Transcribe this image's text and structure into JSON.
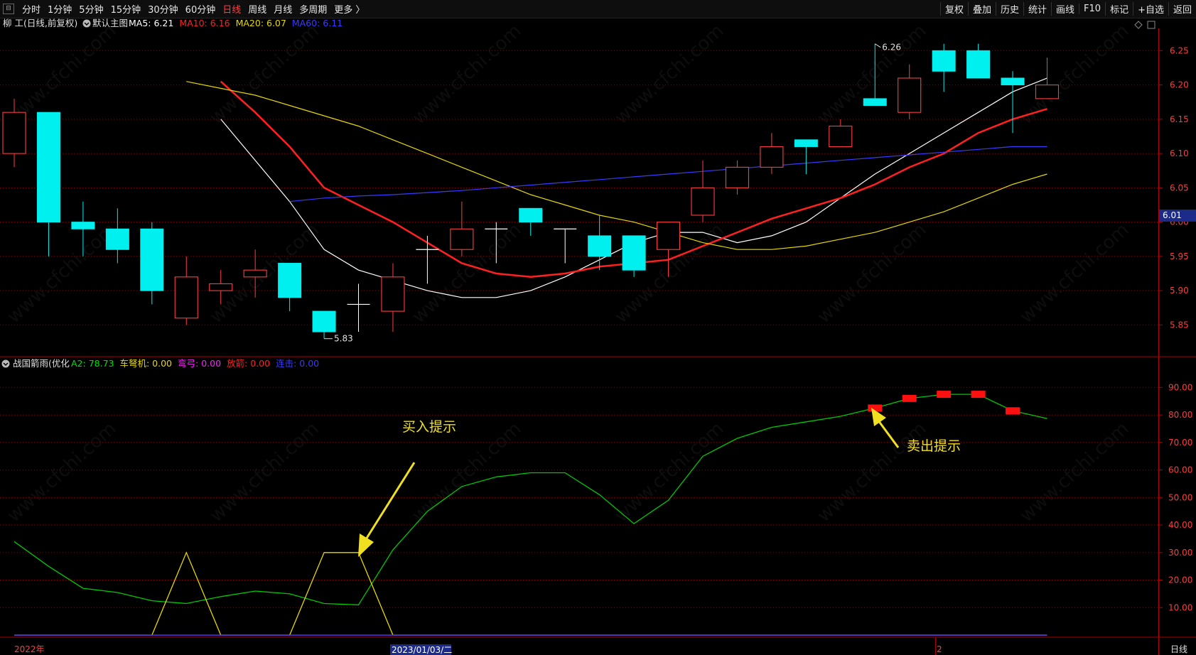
{
  "toolbar": {
    "timeframes": [
      "分时",
      "1分钟",
      "5分钟",
      "15分钟",
      "30分钟",
      "60分钟",
      "日线",
      "周线",
      "月线",
      "多周期",
      "更多 〉"
    ],
    "active_timeframe": "日线",
    "right_buttons": [
      "复权",
      "叠加",
      "历史",
      "统计",
      "画线",
      "F10",
      "标记",
      "+自选",
      "返回"
    ]
  },
  "main_legend": {
    "stock": "柳 工(日线,前复权)",
    "template": "默认主图",
    "ma": [
      {
        "label": "MA5: 6.21",
        "color": "#ffffff"
      },
      {
        "label": "MA10: 6.16",
        "color": "#ff2020"
      },
      {
        "label": "MA20: 6.07",
        "color": "#e6d800"
      },
      {
        "label": "MA60: 6.11",
        "color": "#3a3aff"
      }
    ]
  },
  "indicator_legend": {
    "name": "战国箭雨(优化",
    "items": [
      {
        "label": "A2: 78.73",
        "color": "#00e000"
      },
      {
        "label": "车弩机: 0.00",
        "color": "#e6d800"
      },
      {
        "label": "弯弓: 0.00",
        "color": "#ff20ff"
      },
      {
        "label": "放箭: 0.00",
        "color": "#ff2020"
      },
      {
        "label": "连击: 0.00",
        "color": "#3a3aff"
      }
    ]
  },
  "price_axis": {
    "ticks": [
      "6.25",
      "6.20",
      "6.15",
      "6.10",
      "6.05",
      "6.00",
      "5.95",
      "5.90",
      "5.85"
    ],
    "current_price": "6.01"
  },
  "indicator_axis": {
    "ticks": [
      "90.00",
      "80.00",
      "70.00",
      "60.00",
      "50.00",
      "40.00",
      "30.00",
      "20.00",
      "10.00"
    ]
  },
  "date_axis": {
    "left": "2022年",
    "cursor": "2023/01/03/二",
    "mid": "2",
    "period": "日线"
  },
  "annotations": {
    "high": "6.26",
    "low": "5.83",
    "buy": "买入提示",
    "sell": "卖出提示"
  },
  "watermark": "www.cfchi.com",
  "chart_data": [
    {
      "type": "candlestick",
      "title": "柳 工(日线,前复权)",
      "ylim": [
        5.81,
        6.27
      ],
      "up_color": "#ff3c3c",
      "down_color": "#00f0f0",
      "candles": [
        {
          "o": 6.1,
          "h": 6.18,
          "l": 6.08,
          "c": 6.16
        },
        {
          "o": 6.16,
          "h": 6.16,
          "l": 5.95,
          "c": 6.0
        },
        {
          "o": 6.0,
          "h": 6.03,
          "l": 5.95,
          "c": 5.99
        },
        {
          "o": 5.99,
          "h": 6.02,
          "l": 5.94,
          "c": 5.96
        },
        {
          "o": 5.99,
          "h": 6.0,
          "l": 5.88,
          "c": 5.9
        },
        {
          "o": 5.86,
          "h": 5.95,
          "l": 5.85,
          "c": 5.92
        },
        {
          "o": 5.9,
          "h": 5.93,
          "l": 5.88,
          "c": 5.91
        },
        {
          "o": 5.92,
          "h": 5.96,
          "l": 5.89,
          "c": 5.93
        },
        {
          "o": 5.94,
          "h": 5.94,
          "l": 5.87,
          "c": 5.89
        },
        {
          "o": 5.87,
          "h": 5.87,
          "l": 5.83,
          "c": 5.84
        },
        {
          "o": 5.88,
          "h": 5.91,
          "l": 5.84,
          "c": 5.88
        },
        {
          "o": 5.87,
          "h": 5.94,
          "l": 5.84,
          "c": 5.92
        },
        {
          "o": 5.96,
          "h": 5.98,
          "l": 5.91,
          "c": 5.96
        },
        {
          "o": 5.96,
          "h": 6.03,
          "l": 5.95,
          "c": 5.99
        },
        {
          "o": 5.99,
          "h": 6.0,
          "l": 5.94,
          "c": 5.99
        },
        {
          "o": 6.02,
          "h": 6.02,
          "l": 5.98,
          "c": 6.0
        },
        {
          "o": 5.99,
          "h": 5.99,
          "l": 5.94,
          "c": 5.99
        },
        {
          "o": 5.98,
          "h": 6.01,
          "l": 5.93,
          "c": 5.95
        },
        {
          "o": 5.98,
          "h": 5.98,
          "l": 5.92,
          "c": 5.93
        },
        {
          "o": 5.96,
          "h": 6.0,
          "l": 5.92,
          "c": 6.0
        },
        {
          "o": 6.01,
          "h": 6.09,
          "l": 6.0,
          "c": 6.05
        },
        {
          "o": 6.05,
          "h": 6.09,
          "l": 6.04,
          "c": 6.08
        },
        {
          "o": 6.08,
          "h": 6.13,
          "l": 6.07,
          "c": 6.11
        },
        {
          "o": 6.12,
          "h": 6.12,
          "l": 6.07,
          "c": 6.11
        },
        {
          "o": 6.11,
          "h": 6.15,
          "l": 6.11,
          "c": 6.14
        },
        {
          "o": 6.18,
          "h": 6.26,
          "l": 6.17,
          "c": 6.17
        },
        {
          "o": 6.16,
          "h": 6.23,
          "l": 6.15,
          "c": 6.21
        },
        {
          "o": 6.25,
          "h": 6.26,
          "l": 6.19,
          "c": 6.22
        },
        {
          "o": 6.25,
          "h": 6.26,
          "l": 6.21,
          "c": 6.21
        },
        {
          "o": 6.21,
          "h": 6.22,
          "l": 6.13,
          "c": 6.2
        },
        {
          "o": 6.18,
          "h": 6.24,
          "l": 6.18,
          "c": 6.2
        }
      ],
      "series": [
        {
          "name": "MA5",
          "color": "#ffffff",
          "width": 1.2,
          "values": [
            6.15,
            6.09,
            6.03,
            5.96,
            5.93,
            5.915,
            5.9,
            5.89,
            5.89,
            5.9,
            5.92,
            5.945,
            5.97,
            5.985,
            5.985,
            5.97,
            5.98,
            6.0,
            6.035,
            6.07,
            6.1,
            6.13,
            6.16,
            6.19,
            6.21
          ]
        },
        {
          "name": "MA10",
          "color": "#ff2020",
          "width": 2.5,
          "values": [
            6.205,
            6.16,
            6.11,
            6.05,
            6.025,
            6.0,
            5.97,
            5.94,
            5.925,
            5.92,
            5.925,
            5.935,
            5.94,
            5.945,
            5.965,
            5.985,
            6.005,
            6.02,
            6.035,
            6.055,
            6.08,
            6.1,
            6.13,
            6.15,
            6.165
          ]
        },
        {
          "name": "MA20",
          "color": "#e6d800",
          "width": 1.2,
          "values": [
            6.205,
            6.195,
            6.185,
            6.17,
            6.155,
            6.14,
            6.12,
            6.1,
            6.08,
            6.06,
            6.04,
            6.025,
            6.01,
            6.0,
            5.985,
            5.97,
            5.96,
            5.96,
            5.965,
            5.975,
            5.985,
            6.0,
            6.015,
            6.035,
            6.055,
            6.07
          ]
        },
        {
          "name": "MA60",
          "color": "#3a3aff",
          "width": 1.2,
          "values": [
            6.03,
            6.035,
            6.038,
            6.04,
            6.043,
            6.046,
            6.05,
            6.054,
            6.058,
            6.062,
            6.066,
            6.07,
            6.074,
            6.078,
            6.082,
            6.086,
            6.09,
            6.094,
            6.098,
            6.102,
            6.106,
            6.11,
            6.11
          ]
        }
      ]
    },
    {
      "type": "line",
      "title": "战国箭雨(优化",
      "ylim": [
        0,
        95
      ],
      "series": [
        {
          "name": "A2",
          "color": "#00c800",
          "values": [
            34,
            25,
            17,
            15.5,
            12.5,
            11.5,
            14,
            16,
            15,
            11.5,
            11,
            31,
            45,
            54,
            57.5,
            59,
            59,
            51,
            40.5,
            49,
            65,
            71.5,
            75.5,
            77.5,
            79.5,
            82.5,
            86,
            87.5,
            87.5,
            81.5,
            78.7
          ]
        },
        {
          "name": "车弩机",
          "color": "#e6d800",
          "values": [
            0,
            0,
            0,
            0,
            0,
            30,
            0,
            0,
            0,
            30,
            30,
            0,
            0,
            0,
            0,
            0,
            0,
            0,
            0,
            0,
            0,
            0,
            0,
            0,
            0,
            0,
            0,
            0,
            0,
            0,
            0
          ]
        },
        {
          "name": "弯弓",
          "color": "#ff20ff",
          "values": [
            0,
            0,
            0,
            0,
            0,
            0,
            0,
            0,
            0,
            0,
            0,
            0,
            0,
            0,
            0,
            0,
            0,
            0,
            0,
            0,
            0,
            0,
            0,
            0,
            0,
            0,
            0,
            0,
            0,
            0,
            0
          ]
        },
        {
          "name": "连击",
          "color": "#3a3aff",
          "values": [
            0,
            0,
            0,
            0,
            0,
            0,
            0,
            0,
            0,
            0,
            0,
            0,
            0,
            0,
            0,
            0,
            0,
            0,
            0,
            0,
            0,
            0,
            0,
            0,
            0,
            0,
            0,
            0,
            0,
            0,
            0
          ]
        }
      ],
      "sell_marks": [
        {
          "x": 25,
          "y": 82.5
        },
        {
          "x": 26,
          "y": 86
        },
        {
          "x": 27,
          "y": 87.5
        },
        {
          "x": 28,
          "y": 87.5
        },
        {
          "x": 29,
          "y": 81.5
        }
      ]
    }
  ]
}
